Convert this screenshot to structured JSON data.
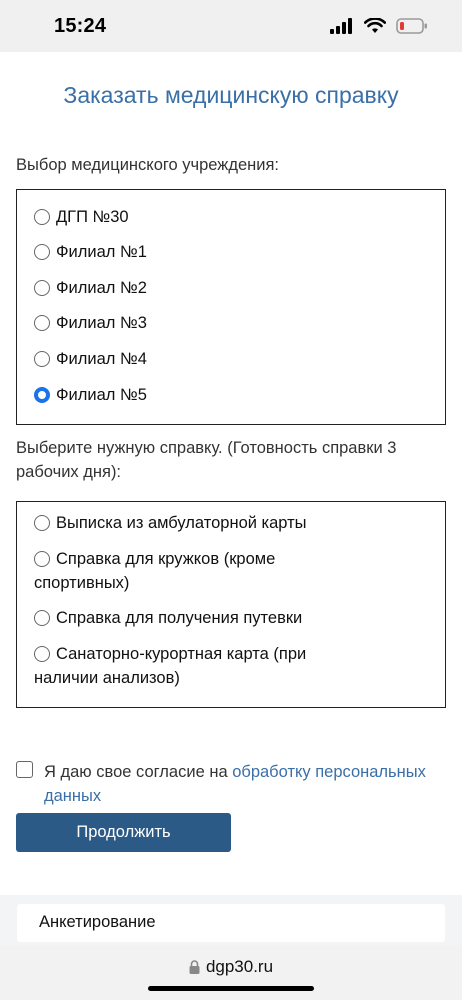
{
  "status_bar": {
    "time": "15:24"
  },
  "page": {
    "title": "Заказать медицинскую справку"
  },
  "institution": {
    "label": "Выбор медицинского учреждения:",
    "options": [
      "ДГП №30",
      "Филиал №1",
      "Филиал №2",
      "Филиал №3",
      "Филиал №4",
      "Филиал №5"
    ],
    "selected": "Филиал №5"
  },
  "certificate": {
    "label_line1": "Выберите нужную справку. (Готовность справки 3",
    "label_line2": "рабочих дня):",
    "options": [
      {
        "line1": "Выписка из амбулаторной карты",
        "line2": ""
      },
      {
        "line1": "Справка для кружков (кроме",
        "line2": "спортивных)"
      },
      {
        "line1": "Справка для получения путевки",
        "line2": ""
      },
      {
        "line1": "Санаторно-курортная карта (при",
        "line2": "наличии анализов)"
      }
    ]
  },
  "consent": {
    "text": "Я даю свое согласие на ",
    "link_line1": "обработку персональных",
    "link_line2": "данных",
    "checked": false
  },
  "continue_button": {
    "label": "Продолжить"
  },
  "footer": {
    "survey_label": "Анкетирование"
  },
  "browser": {
    "url": "dgp30.ru"
  },
  "colors": {
    "accent": "#3a6fa7",
    "button": "#2b5a87",
    "radio_selected": "#1a73e8",
    "battery_low": "#e53935"
  }
}
